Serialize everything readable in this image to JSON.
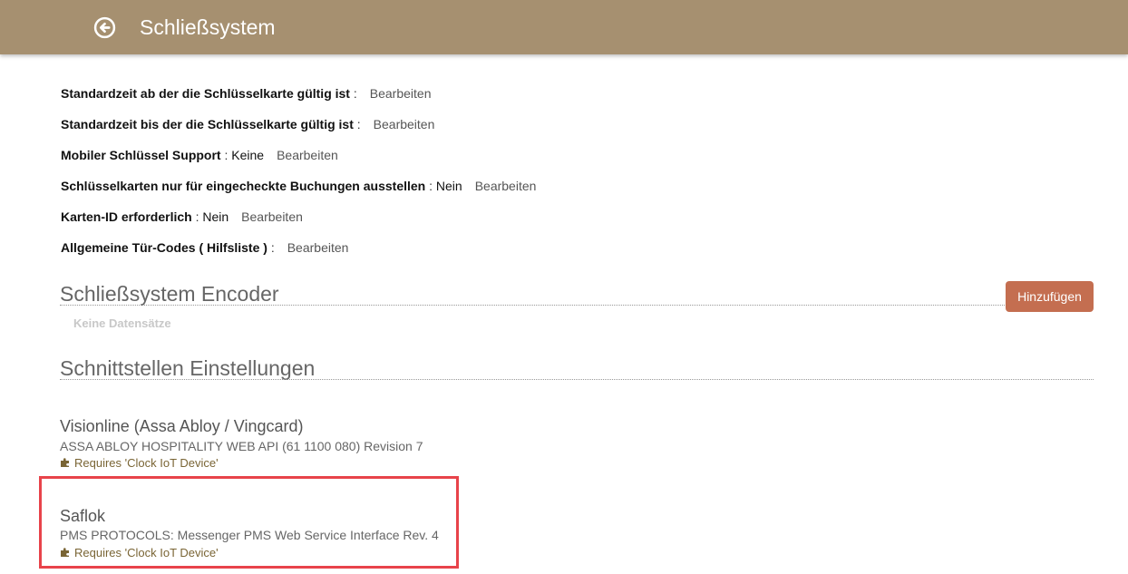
{
  "header": {
    "title": "Schließsystem",
    "back_icon": "arrow-left-circle-icon",
    "background": "#a69070"
  },
  "settings": [
    {
      "label": "Standardzeit ab der die Schlüsselkarte gültig ist",
      "separator": " :",
      "value": "",
      "edit": "Bearbeiten"
    },
    {
      "label": "Standardzeit bis der die Schlüsselkarte gültig ist",
      "separator": " :",
      "value": "",
      "edit": "Bearbeiten"
    },
    {
      "label": "Mobiler Schlüssel Support",
      "separator": " :",
      "value": " Keine",
      "edit": "Bearbeiten"
    },
    {
      "label": "Schlüsselkarten nur für eingecheckte Buchungen ausstellen",
      "separator": " :",
      "value": " Nein",
      "edit": "Bearbeiten"
    },
    {
      "label": "Karten-ID erforderlich",
      "separator": " :",
      "value": " Nein",
      "edit": "Bearbeiten"
    },
    {
      "label": "Allgemeine Tür-Codes ( Hilfsliste )",
      "separator": " :",
      "value": "",
      "edit": "Bearbeiten"
    }
  ],
  "encoder_section": {
    "title": "Schließsystem Encoder",
    "add_label": "Hinzufügen",
    "empty_text": "Keine Datensätze",
    "add_color": "#c46e50"
  },
  "interface_section": {
    "title": "Schnittstellen Einstellungen",
    "items": [
      {
        "name": "Visionline (Assa Abloy / Vingcard)",
        "description": "ASSA ABLOY HOSPITALITY WEB API (61 1100 080) Revision 7",
        "requirement": "Requires 'Clock IoT Device'",
        "icon": "puzzle-piece-icon"
      },
      {
        "name": "Saflok",
        "description": "PMS PROTOCOLS: Messenger PMS Web Service Interface Rev. 4",
        "requirement": "Requires 'Clock IoT Device'",
        "icon": "puzzle-piece-icon"
      }
    ]
  },
  "highlight_color": "#e8434a"
}
